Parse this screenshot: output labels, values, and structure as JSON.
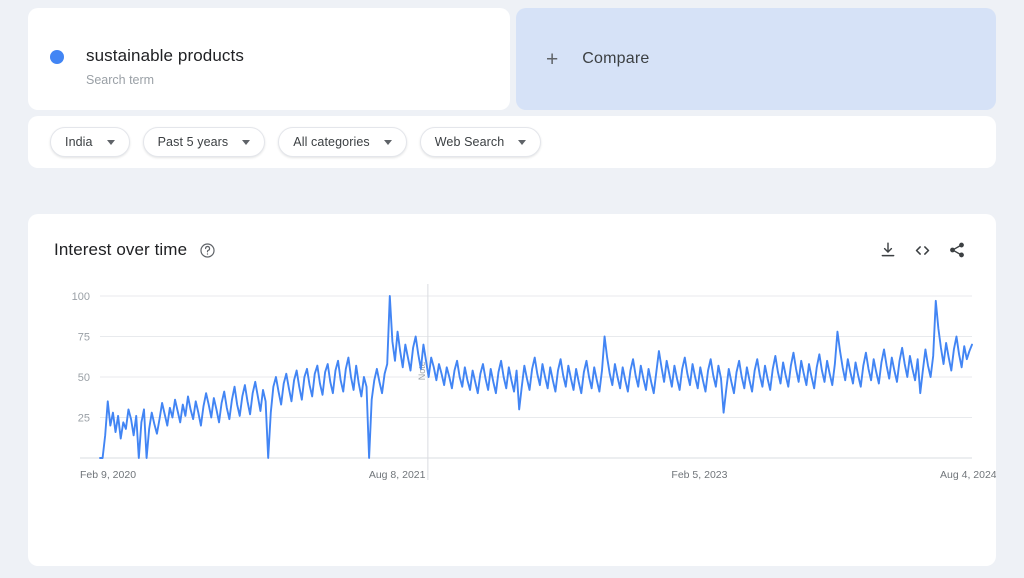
{
  "search": {
    "term": "sustainable products",
    "type_label": "Search term",
    "dot_color": "#4285f4"
  },
  "compare": {
    "label": "Compare",
    "plus_icon": "plus-icon",
    "bg_color": "#d6e2f7"
  },
  "filters": [
    {
      "name": "region",
      "label": "India"
    },
    {
      "name": "time",
      "label": "Past 5 years"
    },
    {
      "name": "category",
      "label": "All categories"
    },
    {
      "name": "search",
      "label": "Web Search"
    }
  ],
  "chart_card": {
    "title": "Interest over time",
    "help_icon": "help-circle-icon",
    "actions": [
      {
        "name": "download-icon",
        "glyph": "download"
      },
      {
        "name": "embed-icon",
        "glyph": "<>"
      },
      {
        "name": "share-icon",
        "glyph": "share"
      }
    ]
  },
  "chart_data": {
    "type": "line",
    "title": "Interest over time",
    "xlabel": "",
    "ylabel": "",
    "ylim": [
      0,
      100
    ],
    "yticks": [
      25,
      50,
      75,
      100
    ],
    "grid": true,
    "legend": "none",
    "line_color": "#4285f4",
    "x_tick_labels": [
      "Feb 9, 2020",
      "Aug 8, 2021",
      "Feb 5, 2023",
      "Aug 4, 2024"
    ],
    "x_tick_positions": [
      0,
      0.345,
      0.692,
      1.0
    ],
    "annotation": {
      "label": "Note",
      "x_fraction": 0.376
    },
    "series": [
      {
        "name": "sustainable products",
        "values": [
          0,
          0,
          14,
          35,
          20,
          28,
          16,
          26,
          12,
          22,
          18,
          30,
          24,
          14,
          26,
          0,
          22,
          30,
          0,
          18,
          28,
          21,
          15,
          24,
          34,
          27,
          20,
          31,
          25,
          36,
          29,
          22,
          33,
          26,
          38,
          30,
          24,
          35,
          28,
          20,
          32,
          40,
          33,
          25,
          37,
          30,
          22,
          34,
          41,
          31,
          24,
          36,
          44,
          33,
          26,
          38,
          45,
          35,
          27,
          40,
          47,
          38,
          29,
          42,
          35,
          0,
          28,
          44,
          50,
          41,
          33,
          46,
          52,
          43,
          35,
          48,
          54,
          44,
          36,
          50,
          55,
          45,
          38,
          52,
          57,
          46,
          39,
          53,
          58,
          47,
          40,
          54,
          60,
          48,
          41,
          55,
          62,
          50,
          42,
          57,
          46,
          38,
          50,
          44,
          0,
          36,
          48,
          55,
          47,
          40,
          52,
          58,
          100,
          72,
          60,
          78,
          66,
          56,
          70,
          62,
          54,
          68,
          75,
          64,
          55,
          70,
          60,
          50,
          62,
          56,
          48,
          58,
          52,
          45,
          56,
          50,
          43,
          54,
          60,
          50,
          44,
          56,
          48,
          42,
          54,
          47,
          40,
          52,
          58,
          49,
          42,
          55,
          47,
          40,
          53,
          60,
          50,
          43,
          56,
          48,
          41,
          54,
          30,
          44,
          57,
          49,
          42,
          55,
          62,
          52,
          45,
          58,
          50,
          43,
          56,
          48,
          41,
          54,
          61,
          51,
          44,
          57,
          49,
          42,
          55,
          47,
          40,
          53,
          60,
          50,
          43,
          56,
          48,
          41,
          54,
          75,
          62,
          52,
          45,
          58,
          50,
          43,
          56,
          48,
          41,
          54,
          61,
          51,
          44,
          57,
          49,
          42,
          55,
          47,
          40,
          53,
          66,
          56,
          47,
          60,
          52,
          44,
          57,
          49,
          42,
          55,
          62,
          52,
          45,
          58,
          50,
          43,
          56,
          48,
          41,
          54,
          61,
          51,
          44,
          57,
          49,
          28,
          42,
          55,
          47,
          40,
          53,
          60,
          50,
          43,
          56,
          48,
          41,
          54,
          61,
          51,
          44,
          57,
          49,
          42,
          55,
          63,
          53,
          46,
          59,
          51,
          44,
          57,
          65,
          55,
          47,
          60,
          52,
          45,
          58,
          50,
          43,
          56,
          64,
          54,
          47,
          60,
          52,
          45,
          58,
          78,
          66,
          56,
          48,
          61,
          53,
          46,
          59,
          51,
          44,
          57,
          65,
          55,
          48,
          61,
          53,
          46,
          59,
          67,
          57,
          49,
          62,
          54,
          47,
          60,
          68,
          58,
          50,
          63,
          55,
          48,
          61,
          40,
          54,
          67,
          57,
          50,
          63,
          97,
          80,
          68,
          58,
          71,
          62,
          54,
          67,
          75,
          64,
          56,
          69,
          61,
          66,
          70
        ]
      }
    ]
  }
}
